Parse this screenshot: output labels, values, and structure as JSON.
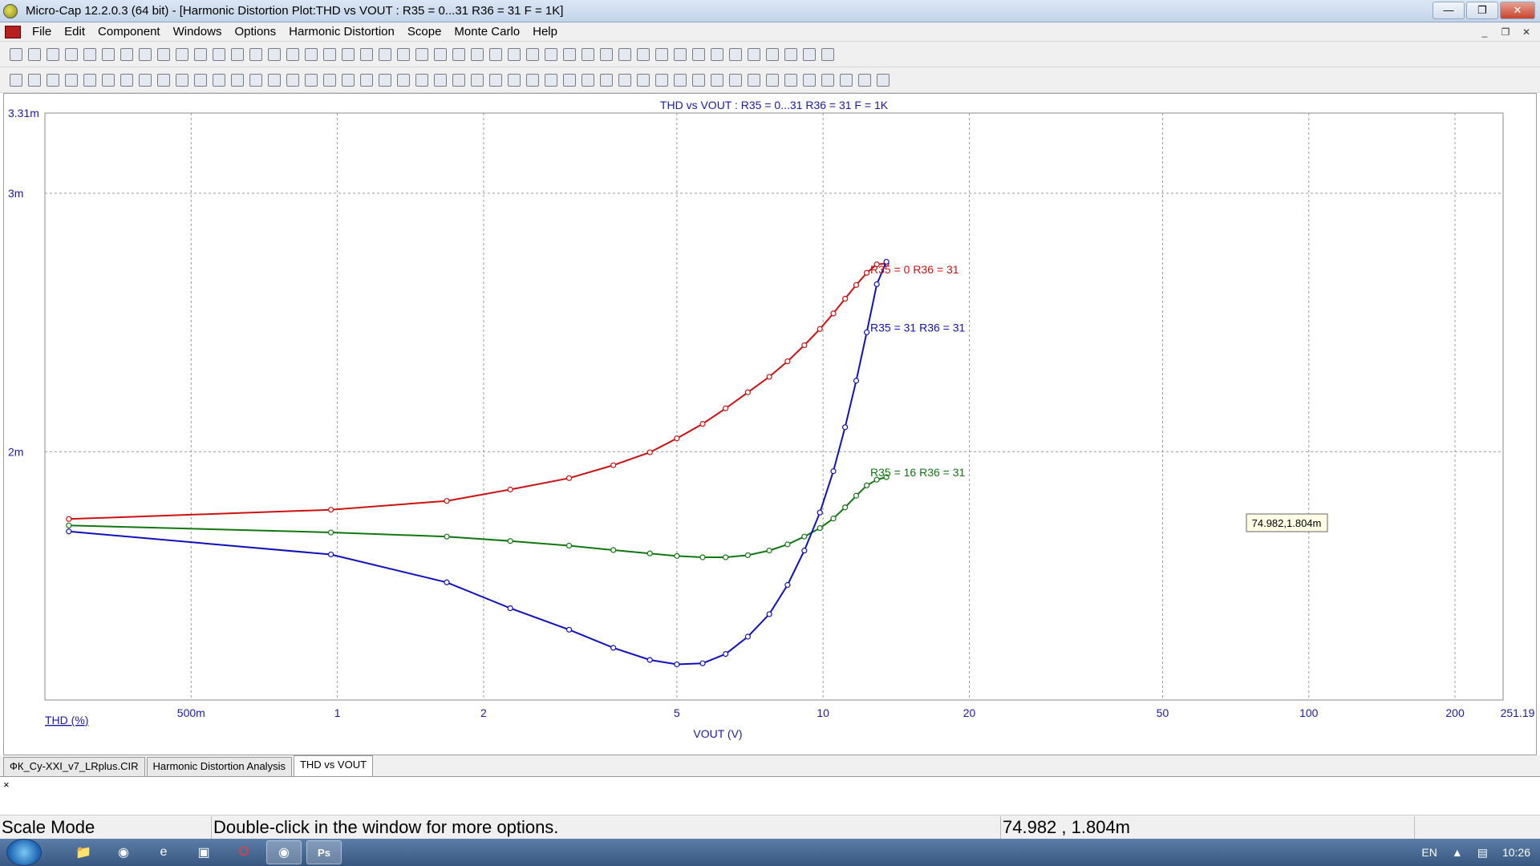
{
  "window": {
    "title": "Micro-Cap 12.2.0.3 (64 bit) - [Harmonic Distortion Plot:THD vs VOUT : R35 = 0...31 R36 = 31 F = 1K]",
    "controls": [
      "minimize",
      "restore",
      "close"
    ]
  },
  "menu": {
    "items": [
      "File",
      "Edit",
      "Component",
      "Windows",
      "Options",
      "Harmonic Distortion",
      "Scope",
      "Monte Carlo",
      "Help"
    ]
  },
  "plot": {
    "title": "THD vs VOUT : R35 = 0...31 R36 = 31 F = 1K",
    "y_ticks": [
      "3.31m",
      "3m",
      "2m"
    ],
    "x_ticks": [
      "500m",
      "1",
      "2",
      "5",
      "10",
      "20",
      "50",
      "100",
      "200",
      "251.19"
    ],
    "y_axis_label": "THD (%)",
    "x_axis_label": "VOUT (V)",
    "cursor_readout": "74.982,1.804m",
    "colors": {
      "red": "#cc1111",
      "blue": "#1111bb",
      "green": "#117711",
      "axis_text": "#1a1aa0",
      "grid": "#888888"
    }
  },
  "chart_data": {
    "type": "line",
    "title": "THD vs VOUT : R35 = 0...31 R36 = 31 F = 1K",
    "xlabel": "VOUT (V)",
    "ylabel": "THD (%)",
    "xscale": "log",
    "xlim": [
      0.25,
      251.19
    ],
    "ylim": [
      0.00104,
      0.00331
    ],
    "grid": true,
    "series": [
      {
        "name": "R35 = 0 R36 = 31",
        "color": "#cc1111",
        "x": [
          0.28,
          0.97,
          1.68,
          2.27,
          3.0,
          3.7,
          4.4,
          5.0,
          5.65,
          6.3,
          7.0,
          7.75,
          8.45,
          9.15,
          9.85,
          10.5,
          11.1,
          11.7,
          12.3,
          12.9,
          13.5
        ],
        "y": [
          0.00174,
          0.001776,
          0.00181,
          0.001854,
          0.001898,
          0.001948,
          0.001998,
          0.002052,
          0.002108,
          0.002168,
          0.00223,
          0.00229,
          0.00235,
          0.002412,
          0.002475,
          0.002535,
          0.002592,
          0.002645,
          0.002692,
          0.002725,
          0.002728
        ]
      },
      {
        "name": "R35 = 16 R36 = 31",
        "color": "#117711",
        "x": [
          0.28,
          0.97,
          1.68,
          2.27,
          3.0,
          3.7,
          4.4,
          5.0,
          5.65,
          6.3,
          7.0,
          7.75,
          8.45,
          9.15,
          9.85,
          10.5,
          11.1,
          11.7,
          12.3,
          12.9,
          13.5
        ],
        "y": [
          0.001715,
          0.001688,
          0.001672,
          0.001655,
          0.001637,
          0.00162,
          0.001607,
          0.001597,
          0.001592,
          0.001592,
          0.0016,
          0.001618,
          0.001642,
          0.001672,
          0.001705,
          0.001742,
          0.001785,
          0.00183,
          0.00187,
          0.001892,
          0.001902
        ]
      },
      {
        "name": "R35 = 31 R36 = 31",
        "color": "#1111bb",
        "x": [
          0.28,
          0.97,
          1.68,
          2.27,
          3.0,
          3.7,
          4.4,
          5.0,
          5.65,
          6.3,
          7.0,
          7.75,
          8.45,
          9.15,
          9.85,
          10.5,
          11.1,
          11.7,
          12.3,
          12.9,
          13.5
        ],
        "y": [
          0.001692,
          0.001603,
          0.001495,
          0.001395,
          0.001312,
          0.001242,
          0.001195,
          0.001178,
          0.001182,
          0.001218,
          0.001285,
          0.001372,
          0.001485,
          0.001618,
          0.001765,
          0.001925,
          0.002095,
          0.002275,
          0.002462,
          0.002648,
          0.002735
        ]
      }
    ]
  },
  "tabs": [
    "ФК_Cy-XXI_v7_LRplus.CIR",
    "Harmonic Distortion Analysis",
    "THD vs VOUT"
  ],
  "status": {
    "mode": "Scale Mode",
    "hint": "Double-click in the window for more options.",
    "coords": "74.982 , 1.804m"
  },
  "taskbar": {
    "lang": "EN",
    "time": "10:26"
  }
}
